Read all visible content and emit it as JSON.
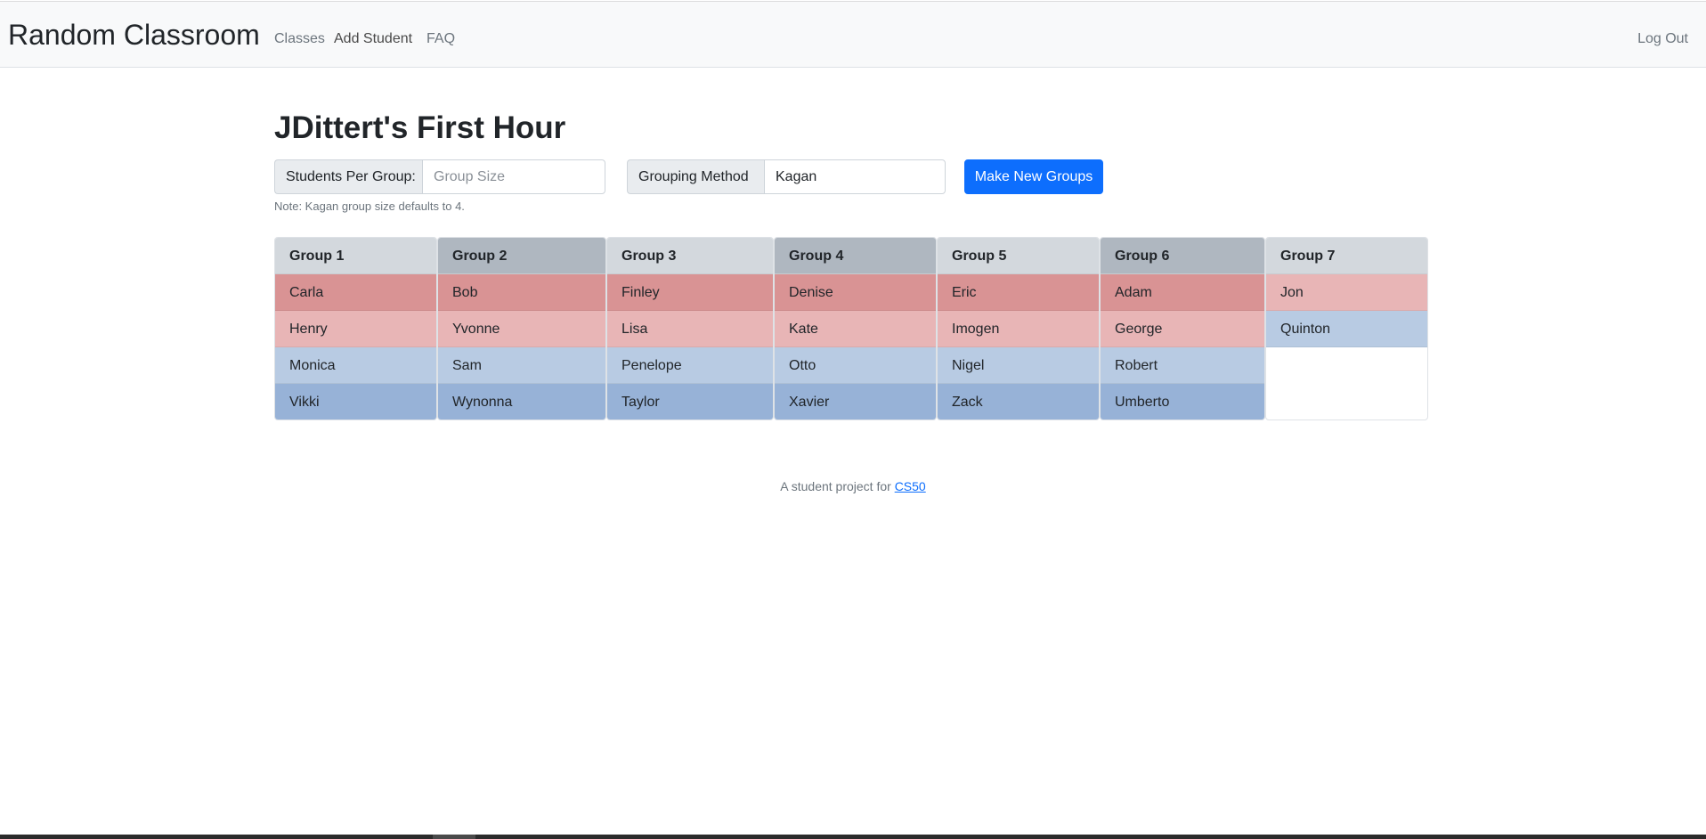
{
  "nav": {
    "brand": "Random Classroom",
    "links": [
      "Classes",
      "Add Student",
      "FAQ"
    ],
    "logout": "Log Out"
  },
  "page": {
    "title": "JDittert's First Hour",
    "size_label": "Students Per Group:",
    "size_placeholder": "Group Size",
    "size_value": "",
    "method_label": "Grouping Method",
    "method_value": "Kagan",
    "button": "Make New Groups",
    "note": "Note: Kagan group size defaults to 4."
  },
  "groups": [
    {
      "name": "Group 1",
      "students": [
        "Carla",
        "Henry",
        "Monica",
        "Vikki"
      ]
    },
    {
      "name": "Group 2",
      "students": [
        "Bob",
        "Yvonne",
        "Sam",
        "Wynonna"
      ]
    },
    {
      "name": "Group 3",
      "students": [
        "Finley",
        "Lisa",
        "Penelope",
        "Taylor"
      ]
    },
    {
      "name": "Group 4",
      "students": [
        "Denise",
        "Kate",
        "Otto",
        "Xavier"
      ]
    },
    {
      "name": "Group 5",
      "students": [
        "Eric",
        "Imogen",
        "Nigel",
        "Zack"
      ]
    },
    {
      "name": "Group 6",
      "students": [
        "Adam",
        "George",
        "Robert",
        "Umberto"
      ]
    },
    {
      "name": "Group 7",
      "students": [
        "Jon",
        "Quinton"
      ]
    }
  ],
  "colors": {
    "header_light": "#d3d8dd",
    "header_dark": "#afb7c0",
    "row_1": "#d99394",
    "row_2": "#e8b5b6",
    "row_3": "#b8cbe3",
    "row_4": "#97b2d7",
    "primary": "#0d6efd"
  },
  "footer": {
    "text": "A student project for ",
    "link": "CS50"
  }
}
